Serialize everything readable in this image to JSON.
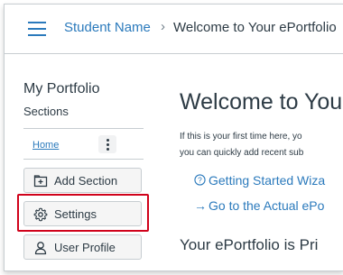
{
  "header": {
    "breadcrumb_student": "Student Name",
    "breadcrumb_separator": "›",
    "breadcrumb_current": "Welcome to Your ePortfolio"
  },
  "sidebar": {
    "title": "My Portfolio",
    "sections_label": "Sections",
    "home_link": "Home",
    "buttons": [
      {
        "label": "Add Section",
        "icon": "add-section-icon"
      },
      {
        "label": "Settings",
        "icon": "gear-icon"
      },
      {
        "label": "User Profile",
        "icon": "user-icon"
      }
    ]
  },
  "main": {
    "heading": "Welcome to Your",
    "intro_line1": "If this is your first time here, yo",
    "intro_line2": "you can quickly add recent sub",
    "links": [
      {
        "glyph": "?",
        "label": "Getting Started Wiza"
      },
      {
        "glyph": "→",
        "label": "Go to the Actual ePo"
      }
    ],
    "privacy_heading": "Your ePortfolio is Pri"
  },
  "colors": {
    "link": "#2b7abc",
    "text": "#2d3b45",
    "highlight": "#d0021b"
  }
}
